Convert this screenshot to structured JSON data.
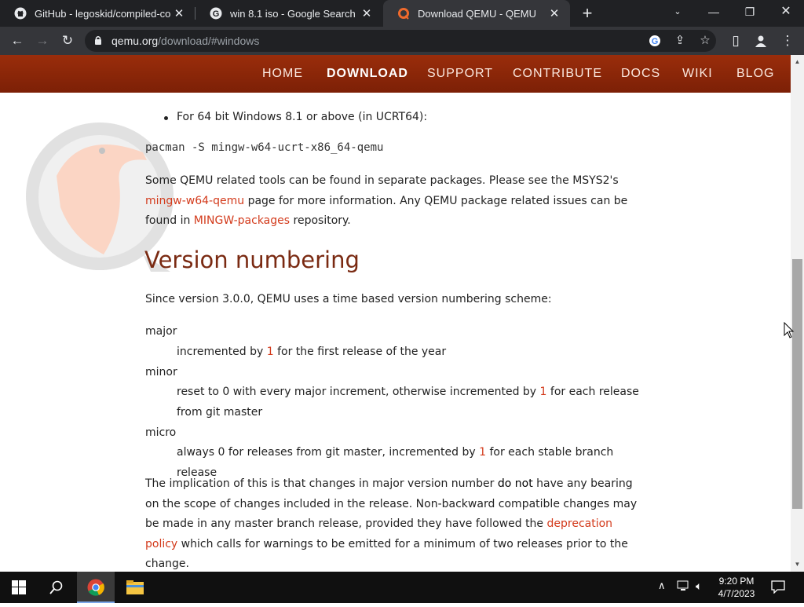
{
  "browser": {
    "tabs": [
      {
        "title": "GitHub - legoskid/compiled-colla",
        "icon": "github-icon",
        "active": false
      },
      {
        "title": "win 8.1 iso - Google Search",
        "icon": "google-icon",
        "active": false
      },
      {
        "title": "Download QEMU - QEMU",
        "icon": "qemu-icon",
        "active": true
      }
    ],
    "new_tab": "+",
    "url_host": "qemu.org",
    "url_path": "/download/#windows"
  },
  "site_nav": {
    "items": [
      "HOME",
      "DOWNLOAD",
      "SUPPORT",
      "CONTRIBUTE",
      "DOCS",
      "WIKI",
      "BLOG"
    ],
    "active": "DOWNLOAD"
  },
  "content": {
    "bullet_64bit": "For 64 bit Windows 8.1 or above (in UCRT64):",
    "code_cmd": "pacman -S mingw-w64-ucrt-x86_64-qemu",
    "tools_p": {
      "pre": "Some QEMU related tools can be found in separate packages. Please see the MSYS2's ",
      "link1": "mingw-w64-qemu",
      "mid": " page for more information. Any QEMU package related issues can be found in ",
      "link2": "MINGW-packages",
      "post": " repository."
    },
    "heading": "Version numbering",
    "since": "Since version 3.0.0, QEMU uses a time based version numbering scheme:",
    "definitions": [
      {
        "term": "major",
        "pre": "incremented by ",
        "num": "1",
        "post": " for the first release of the year"
      },
      {
        "term": "minor",
        "pre": "reset to 0 with every major increment, otherwise incremented by ",
        "num": "1",
        "post": " for each release from git master"
      },
      {
        "term": "micro",
        "pre": "always 0 for releases from git master, incremented by ",
        "num": "1",
        "post": " for each stable branch release"
      }
    ],
    "implication": {
      "pre": "The implication of this is that changes in major version number ",
      "bold": "do not",
      "mid": " have any bearing on the scope of changes included in the release. Non-backward compatible changes may be made in any master branch release, provided they have followed the ",
      "link": "deprecation policy",
      "post": " which calls for warnings to be emitted for a minimum of two releases prior to the change."
    }
  },
  "taskbar": {
    "time": "9:20 PM",
    "date": "4/7/2023"
  }
}
